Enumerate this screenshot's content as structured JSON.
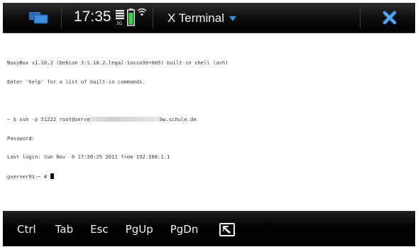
{
  "status_bar": {
    "time": "17:35",
    "network_type": "3G",
    "icons": [
      "task-switcher-icon",
      "signal-strength-icon",
      "battery-icon",
      "wifi-icon",
      "dropdown-arrow-icon",
      "close-icon"
    ],
    "accent_color": "#3a8fe0"
  },
  "app": {
    "title": "X Terminal"
  },
  "terminal": {
    "lines": [
      "BusyBox v1.10.2 (Debian 3:1.10.2.legal-1osso30+0m5) built-in shell (ash)",
      "Enter 'help' for a list of built-in commands.",
      "",
      "~ $ ssh -p 51222 root@serve",
      "Password:",
      "Last login: Sun Nov  6 17:30:25 2011 from 192.168.1.1",
      "gserver03:~ # "
    ],
    "ssh_host_suffix": "bw.schule.de",
    "background": "#ffffff",
    "text_color": "#3a3a3a"
  },
  "softkeys": {
    "items": [
      "Ctrl",
      "Tab",
      "Esc",
      "PgUp",
      "PgDn"
    ],
    "last_icon": "screen-toggle-icon"
  }
}
